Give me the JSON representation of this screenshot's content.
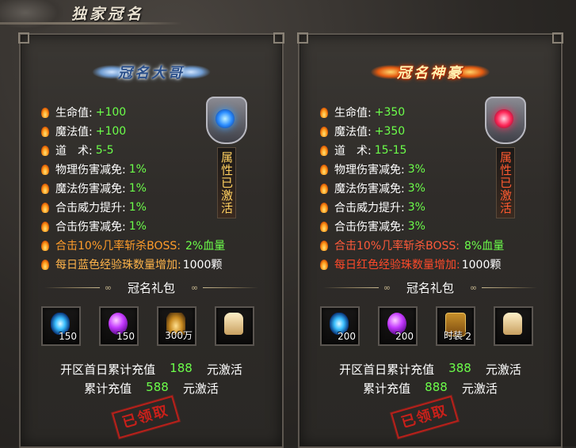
{
  "page": {
    "title": "独家冠名"
  },
  "panels": [
    {
      "badge": "冠名大哥",
      "theme": "blue",
      "attr_status": "属性已激活",
      "stats": [
        {
          "label": "生命值:",
          "value": "+100"
        },
        {
          "label": "魔法值:",
          "value": "+100"
        },
        {
          "label": "道　术:",
          "value": "5-5"
        },
        {
          "label": "物理伤害减免:",
          "value": "1%"
        },
        {
          "label": "魔法伤害减免:",
          "value": "1%"
        },
        {
          "label": "合击威力提升:",
          "value": "1%"
        },
        {
          "label": "合击伤害减免:",
          "value": "1%"
        }
      ],
      "special1": {
        "label": "合击10%几率斩杀BOSS:",
        "value": "2%血量"
      },
      "special2": {
        "label": "每日蓝色经验珠数量增加:",
        "value": "1000颗"
      },
      "gift_title": "冠名礼包",
      "items": [
        {
          "icon": "blue-crystal-icon",
          "count": "150"
        },
        {
          "icon": "purple-orb-icon",
          "count": "150"
        },
        {
          "icon": "gold-ingot-icon",
          "count": "300万"
        },
        {
          "icon": "bone-hand-icon",
          "count": ""
        }
      ],
      "cond1": {
        "label": "开区首日累计充值",
        "amount": "188",
        "suffix": "元激活"
      },
      "cond2": {
        "label": "累计充值",
        "amount": "588",
        "suffix": "元激活"
      },
      "stamp": "已领取"
    },
    {
      "badge": "冠名神豪",
      "theme": "red",
      "attr_status": "属性已激活",
      "stats": [
        {
          "label": "生命值:",
          "value": "+350"
        },
        {
          "label": "魔法值:",
          "value": "+350"
        },
        {
          "label": "道　术:",
          "value": "15-15"
        },
        {
          "label": "物理伤害减免:",
          "value": "3%"
        },
        {
          "label": "魔法伤害减免:",
          "value": "3%"
        },
        {
          "label": "合击威力提升:",
          "value": "3%"
        },
        {
          "label": "合击伤害减免:",
          "value": "3%"
        }
      ],
      "special1": {
        "label": "合击10%几率斩杀BOSS:",
        "value": "8%血量"
      },
      "special2": {
        "label": "每日红色经验珠数量增加:",
        "value": "1000颗"
      },
      "gift_title": "冠名礼包",
      "items": [
        {
          "icon": "blue-crystal-icon",
          "count": "200"
        },
        {
          "icon": "purple-orb-icon",
          "count": "200"
        },
        {
          "icon": "treasure-chest-icon",
          "count": "时装",
          "count_b": "2"
        },
        {
          "icon": "bone-hand-icon",
          "count": ""
        }
      ],
      "cond1": {
        "label": "开区首日累计充值",
        "amount": "388",
        "suffix": "元激活"
      },
      "cond2": {
        "label": "累计充值",
        "amount": "888",
        "suffix": "元激活"
      },
      "stamp": "已领取"
    }
  ]
}
